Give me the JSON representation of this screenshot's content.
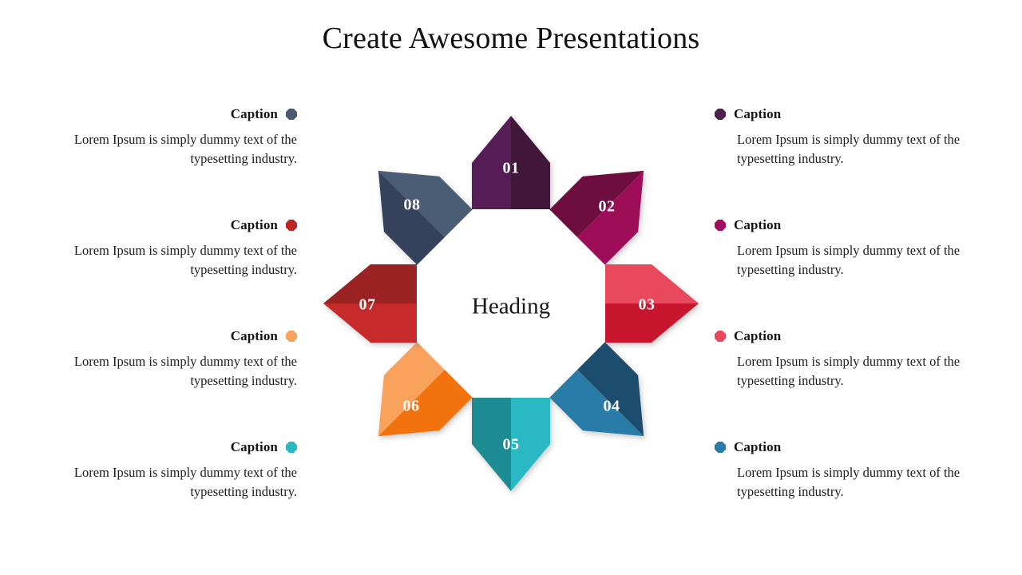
{
  "slide": {
    "title": "Create Awesome Presentations",
    "background_color": "#ffffff"
  },
  "diagram": {
    "center_label": "Heading",
    "petals": [
      {
        "number": "01",
        "position": "top",
        "color_light": "#571A55",
        "color_dark": "#40163B"
      },
      {
        "number": "02",
        "position": "top-right",
        "color_light": "#9E1159",
        "color_dark": "#6D1040"
      },
      {
        "number": "03",
        "position": "right",
        "color_light": "#E8495B",
        "color_dark": "#C8192E"
      },
      {
        "number": "04",
        "position": "bottom-right",
        "color_light": "#2A7BA8",
        "color_dark": "#1D4E6E"
      },
      {
        "number": "05",
        "position": "bottom",
        "color_light": "#2BB8C4",
        "color_dark": "#1C8C92"
      },
      {
        "number": "06",
        "position": "bottom-left",
        "color_light": "#F9A25B",
        "color_dark": "#F2720C"
      },
      {
        "number": "07",
        "position": "left",
        "color_light": "#C62B2B",
        "color_dark": "#9B2220"
      },
      {
        "number": "08",
        "position": "top-left",
        "color_light": "#4C5B74",
        "color_dark": "#36435C"
      }
    ]
  },
  "captions": {
    "left": [
      {
        "title": "Caption",
        "body": "Lorem Ipsum is simply dummy text of the typesetting industry.",
        "dot_color": "#495A71"
      },
      {
        "title": "Caption",
        "body": "Lorem Ipsum is simply dummy text of the typesetting industry.",
        "dot_color": "#BE2422"
      },
      {
        "title": "Caption",
        "body": "Lorem Ipsum is simply dummy text of the typesetting industry.",
        "dot_color": "#F9A25B"
      },
      {
        "title": "Caption",
        "body": "Lorem Ipsum is simply dummy text of the typesetting industry.",
        "dot_color": "#2BB8C4"
      }
    ],
    "right": [
      {
        "title": "Caption",
        "body": "Lorem Ipsum is simply dummy text of the typesetting industry.",
        "dot_color": "#4E2050"
      },
      {
        "title": "Caption",
        "body": "Lorem Ipsum is simply dummy text of the typesetting industry.",
        "dot_color": "#A01060"
      },
      {
        "title": "Caption",
        "body": "Lorem Ipsum is simply dummy text of the typesetting industry.",
        "dot_color": "#E8495B"
      },
      {
        "title": "Caption",
        "body": "Lorem Ipsum is simply dummy text of the typesetting industry.",
        "dot_color": "#2A7BA8"
      }
    ]
  }
}
